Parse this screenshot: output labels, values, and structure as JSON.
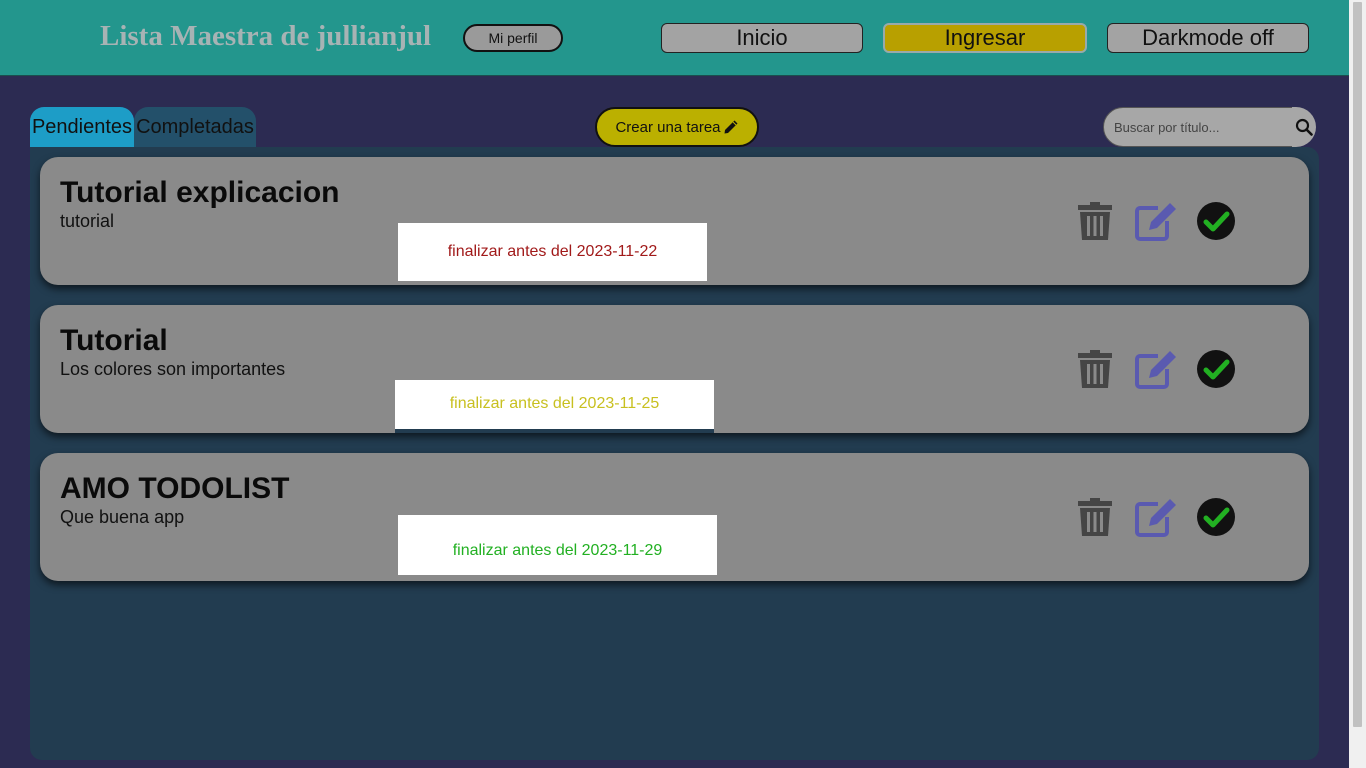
{
  "header": {
    "title": "Lista Maestra de jullianjul",
    "profile_label": "Mi perfil",
    "nav": {
      "inicio": "Inicio",
      "ingresar": "Ingresar",
      "darkmode": "Darkmode off"
    }
  },
  "tabs": {
    "pendientes": "Pendientes",
    "completadas": "Completadas"
  },
  "create_label": "Crear una tarea",
  "search": {
    "placeholder": "Buscar por título..."
  },
  "tasks": [
    {
      "title": "Tutorial explicacion",
      "description": "tutorial",
      "deadline": "finalizar antes del 2023-11-22",
      "deadline_color": "#a11a1a"
    },
    {
      "title": "Tutorial",
      "description": "Los colores son importantes",
      "deadline": "finalizar antes del 2023-11-25",
      "deadline_color": "#c8c020"
    },
    {
      "title": "AMO TODOLIST",
      "description": "Que buena app",
      "deadline": "finalizar antes del 2023-11-29",
      "deadline_color": "#22b022"
    }
  ],
  "icons": {
    "delete": "trash-icon",
    "edit": "edit-icon",
    "complete": "check-circle-icon",
    "search": "search-icon",
    "create": "pencil-icon"
  },
  "colors": {
    "header_bg": "#23968d",
    "page_bg": "#2c2b52",
    "panel_bg": "#223c50",
    "card_bg": "#8a8a8a",
    "accent_yellow": "#bbb000",
    "tab_active": "#1d9dc7",
    "edit_icon": "#5a5ab0",
    "check_icon": "#22b022"
  }
}
